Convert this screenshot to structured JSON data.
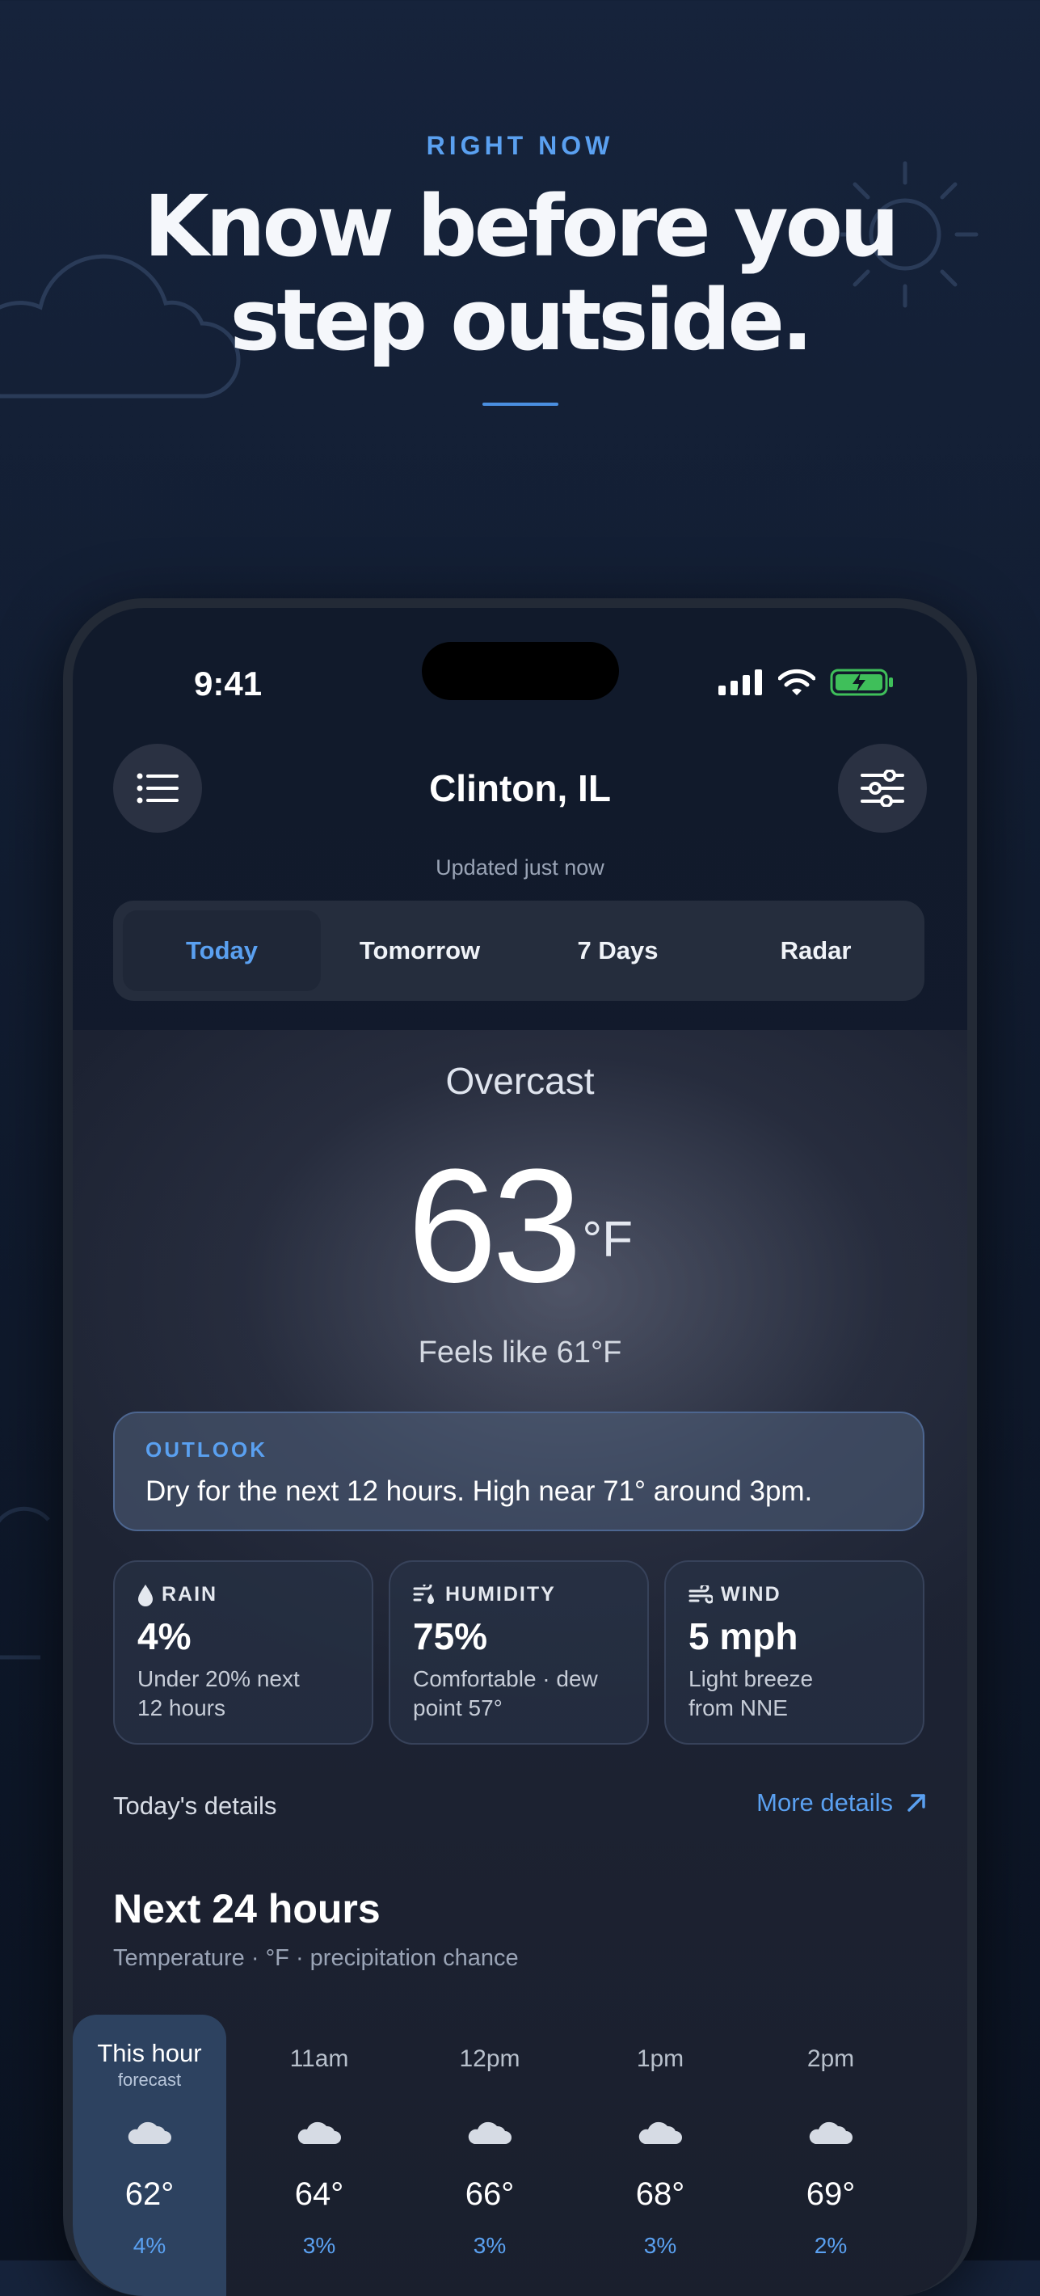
{
  "promo": {
    "eyebrow": "RIGHT NOW",
    "headline_line1": "Know before you",
    "headline_line2": "step outside."
  },
  "status_bar": {
    "time": "9:41"
  },
  "header": {
    "city": "Clinton, IL",
    "updated": "Updated just now"
  },
  "tabs": [
    {
      "label": "Today",
      "active": true
    },
    {
      "label": "Tomorrow"
    },
    {
      "label": "7 Days"
    },
    {
      "label": "Radar"
    }
  ],
  "current": {
    "condition": "Overcast",
    "temperature": "63",
    "unit": "°F",
    "feels_like": "Feels like 61°F"
  },
  "outlook": {
    "label": "OUTLOOK",
    "text": "Dry for the next 12 hours. High near 71° around 3pm."
  },
  "metrics": [
    {
      "label": "RAIN",
      "value": "4%",
      "desc_line1": "Under 20% next",
      "desc_line2": "12 hours",
      "icon": "raindrop-icon"
    },
    {
      "label": "HUMIDITY",
      "value": "75%",
      "desc_line1": "Comfortable · dew",
      "desc_line2": "point 57°",
      "icon": "humidity-icon"
    },
    {
      "label": "WIND",
      "value": "5 mph",
      "desc_line1": "Light breeze",
      "desc_line2": "from NNE",
      "icon": "wind-icon"
    }
  ],
  "details": {
    "label": "Today's details",
    "more": "More details"
  },
  "hourly": {
    "title": "Next 24 hours",
    "subtitle": "Temperature · °F · precipitation chance",
    "hours": [
      {
        "time": "This hour",
        "sub": "forecast",
        "temp": "62°",
        "precip": "4%",
        "current": true
      },
      {
        "time": "11am",
        "temp": "64°",
        "precip": "3%"
      },
      {
        "time": "12pm",
        "temp": "66°",
        "precip": "3%"
      },
      {
        "time": "1pm",
        "temp": "68°",
        "precip": "3%"
      },
      {
        "time": "2pm",
        "temp": "69°",
        "precip": "2%"
      }
    ]
  },
  "colors": {
    "accent": "#5aa0f0",
    "background": "#131c2d"
  }
}
